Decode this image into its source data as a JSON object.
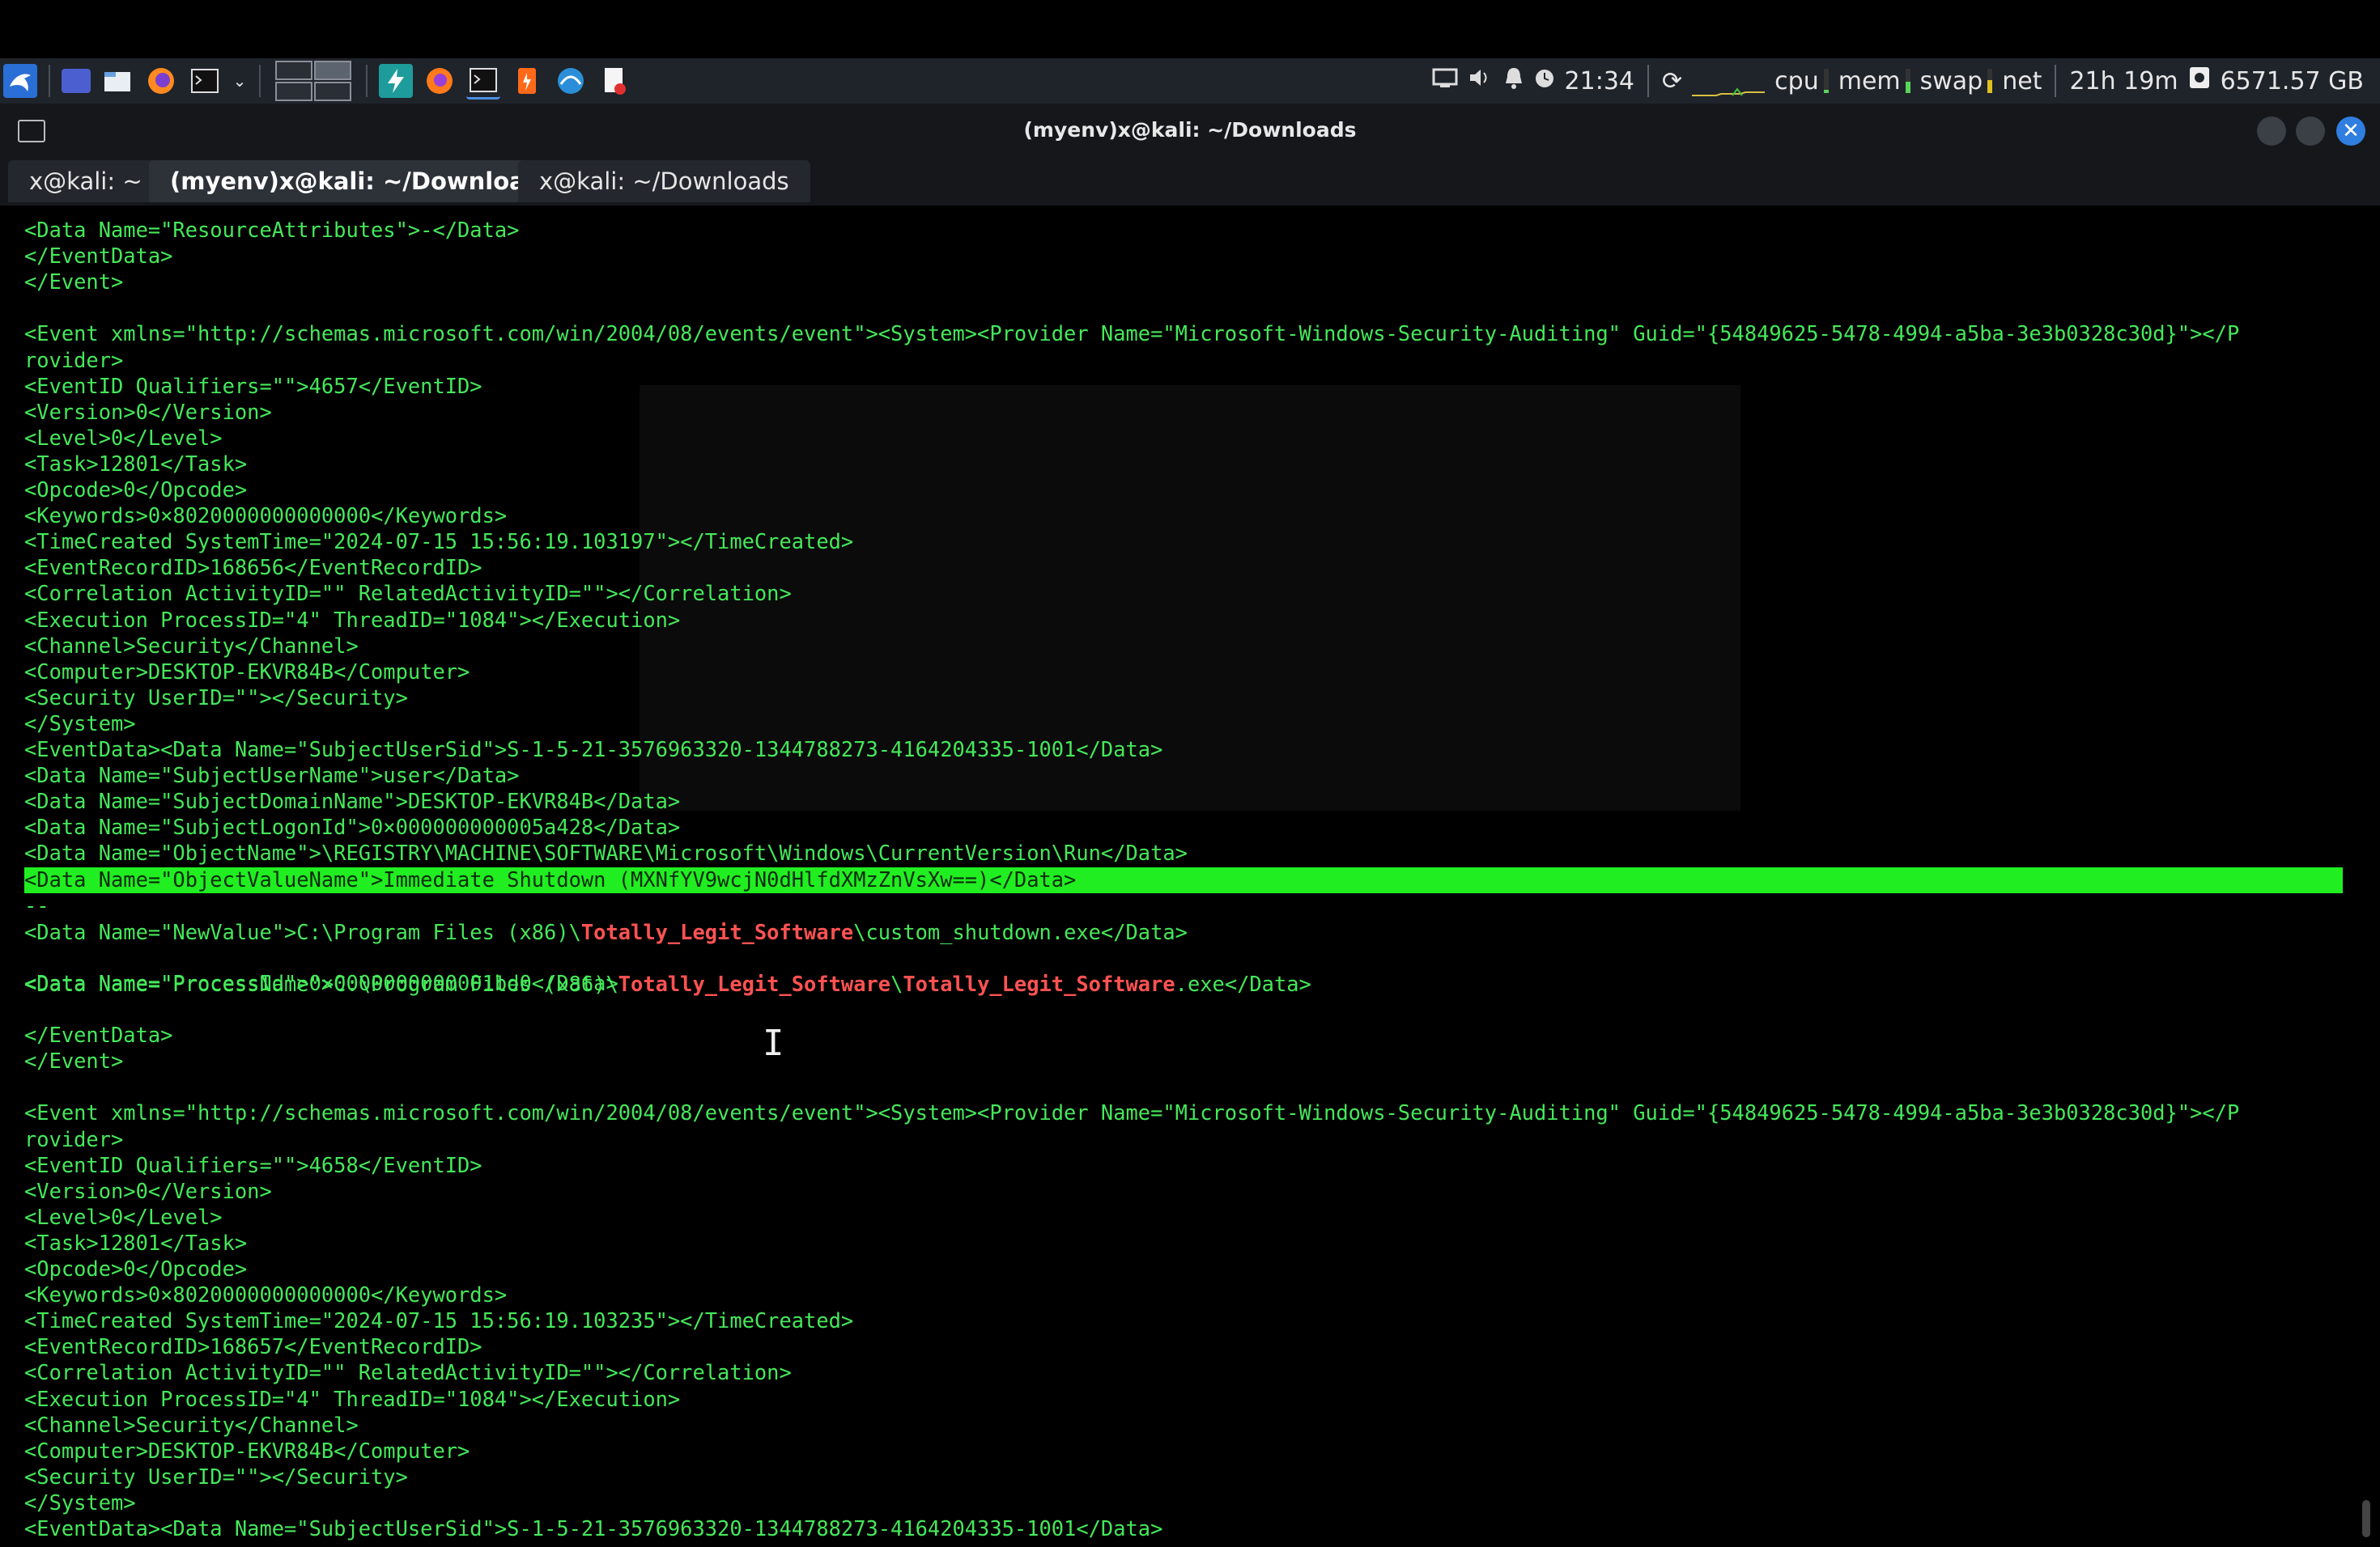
{
  "panel": {
    "clock": "21:34",
    "monitors": {
      "cpu": "cpu",
      "mem": "mem",
      "swap": "swap",
      "net": "net"
    },
    "uptime": "21h 19m",
    "disk": "6571.57 GB"
  },
  "window": {
    "title": "(myenv)x@kali: ~/Downloads",
    "close_glyph": "✕"
  },
  "tabs": [
    {
      "label": "x@kali: ~"
    },
    {
      "label": "(myenv)x@kali: ~/Downloads"
    },
    {
      "label": "x@kali: ~/Downloads"
    }
  ],
  "terminal": {
    "lines": [
      "<Data Name=\"ResourceAttributes\">-</Data>",
      "</EventData>",
      "</Event>",
      "",
      "<Event xmlns=\"http://schemas.microsoft.com/win/2004/08/events/event\"><System><Provider Name=\"Microsoft-Windows-Security-Auditing\" Guid=\"{54849625-5478-4994-a5ba-3e3b0328c30d}\"></P",
      "rovider>",
      "<EventID Qualifiers=\"\">4657</EventID>",
      "<Version>0</Version>",
      "<Level>0</Level>",
      "<Task>12801</Task>",
      "<Opcode>0</Opcode>",
      "<Keywords>0×8020000000000000</Keywords>",
      "<TimeCreated SystemTime=\"2024-07-15 15:56:19.103197\"></TimeCreated>",
      "<EventRecordID>168656</EventRecordID>",
      "<Correlation ActivityID=\"\" RelatedActivityID=\"\"></Correlation>",
      "<Execution ProcessID=\"4\" ThreadID=\"1084\"></Execution>",
      "<Channel>Security</Channel>",
      "<Computer>DESKTOP-EKVR84B</Computer>",
      "<Security UserID=\"\"></Security>",
      "</System>",
      "<EventData><Data Name=\"SubjectUserSid\">S-1-5-21-3576963320-1344788273-4164204335-1001</Data>",
      "<Data Name=\"SubjectUserName\">user</Data>",
      "<Data Name=\"SubjectDomainName\">DESKTOP-EKVR84B</Data>",
      "<Data Name=\"SubjectLogonId\">0×000000000005a428</Data>",
      "<Data Name=\"ObjectName\">\\REGISTRY\\MACHINE\\SOFTWARE\\Microsoft\\Windows\\CurrentVersion\\Run</Data>",
      "<Data Name=\"ObjectValueName\">Immediate Shutdown (MXNfYV9wcjN0dHlfdXMzZnVsXw==)</Data>",
      "--",
      "",
      "",
      "<Data Name=\"ProcessId\">0×0000000000001bd0</Data>",
      "",
      "</EventData>",
      "</Event>",
      "",
      "<Event xmlns=\"http://schemas.microsoft.com/win/2004/08/events/event\"><System><Provider Name=\"Microsoft-Windows-Security-Auditing\" Guid=\"{54849625-5478-4994-a5ba-3e3b0328c30d}\"></P",
      "rovider>",
      "<EventID Qualifiers=\"\">4658</EventID>",
      "<Version>0</Version>",
      "<Level>0</Level>",
      "<Task>12801</Task>",
      "<Opcode>0</Opcode>",
      "<Keywords>0×8020000000000000</Keywords>",
      "<TimeCreated SystemTime=\"2024-07-15 15:56:19.103235\"></TimeCreated>",
      "<EventRecordID>168657</EventRecordID>",
      "<Correlation ActivityID=\"\" RelatedActivityID=\"\"></Correlation>",
      "<Execution ProcessID=\"4\" ThreadID=\"1084\"></Execution>",
      "<Channel>Security</Channel>",
      "<Computer>DESKTOP-EKVR84B</Computer>",
      "<Security UserID=\"\"></Security>",
      "</System>",
      "<EventData><Data Name=\"SubjectUserSid\">S-1-5-21-3576963320-1344788273-4164204335-1001</Data>"
    ],
    "newvalue_prefix": "<Data Name=\"NewValue\">C:\\Program Files (x86)\\",
    "match": "Totally_Legit_Software",
    "newvalue_suffix": "\\custom_shutdown.exe</Data>",
    "processname_prefix": "<Data Name=\"ProcessName\">C:\\Program Files (x86)\\",
    "processname_sep": "\\",
    "processname_suffix": ".exe</Data>"
  },
  "colors": {
    "terminal_text": "#45e85a",
    "highlight": "#21ee21",
    "match": "#ff5252",
    "panel_bg": "#1f232a"
  }
}
